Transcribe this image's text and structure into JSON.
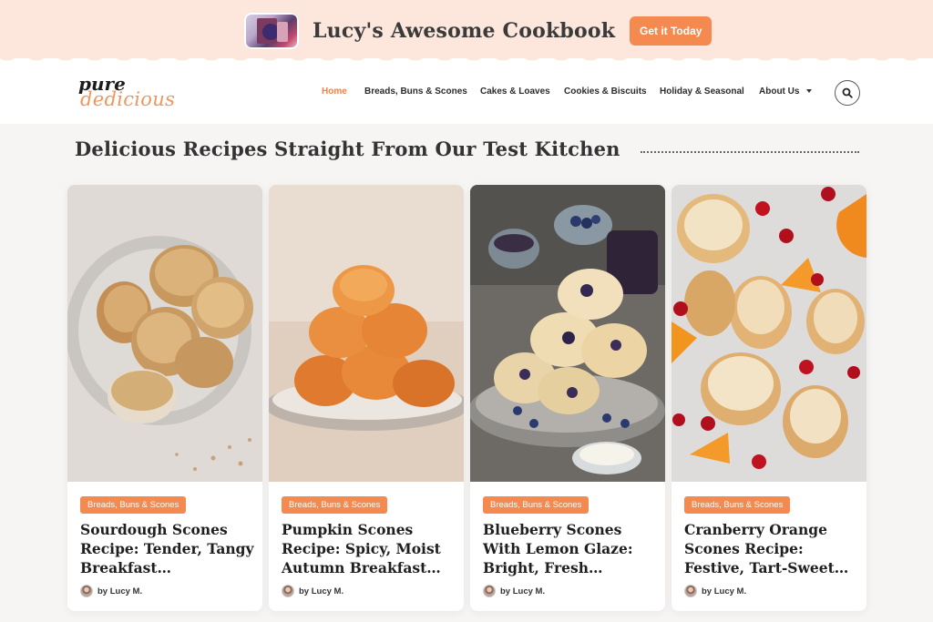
{
  "promo": {
    "title": "Lucy's Awesome Cookbook",
    "cta_label": "Get it Today"
  },
  "header": {
    "logo_line1": "pure",
    "logo_line2": "dedicious",
    "nav": [
      {
        "label": "Home",
        "active": true
      },
      {
        "label": "Breads, Buns & Scones"
      },
      {
        "label": "Cakes & Loaves"
      },
      {
        "label": "Cookies & Biscuits"
      },
      {
        "label": "Holiday & Seasonal"
      },
      {
        "label": "About Us"
      }
    ],
    "search_icon": "search-icon"
  },
  "section": {
    "title": "Delicious Recipes Straight From Our Test Kitchen"
  },
  "cards": [
    {
      "category": "Breads, Buns & Scones",
      "title": "Sourdough Scones Recipe: Tender, Tangy Breakfast…",
      "author": "by Lucy M.",
      "image": "plain sourdough scones on plate"
    },
    {
      "category": "Breads, Buns & Scones",
      "title": "Pumpkin Scones Recipe: Spicy, Moist Autumn Breakfast…",
      "author": "by Lucy M.",
      "image": "stacked pumpkin scones on plate"
    },
    {
      "category": "Breads, Buns & Scones",
      "title": "Blueberry Scones With Lemon Glaze: Bright, Fresh…",
      "author": "by Lucy M.",
      "image": "blueberry scones with jam and cream"
    },
    {
      "category": "Breads, Buns & Scones",
      "title": "Cranberry Orange Scones Recipe: Festive, Tart-Sweet…",
      "author": "by Lucy M.",
      "image": "glazed cranberry orange scones on marble"
    }
  ],
  "colors": {
    "accent": "#f48a4f",
    "promo_bg": "#fde7dd"
  }
}
